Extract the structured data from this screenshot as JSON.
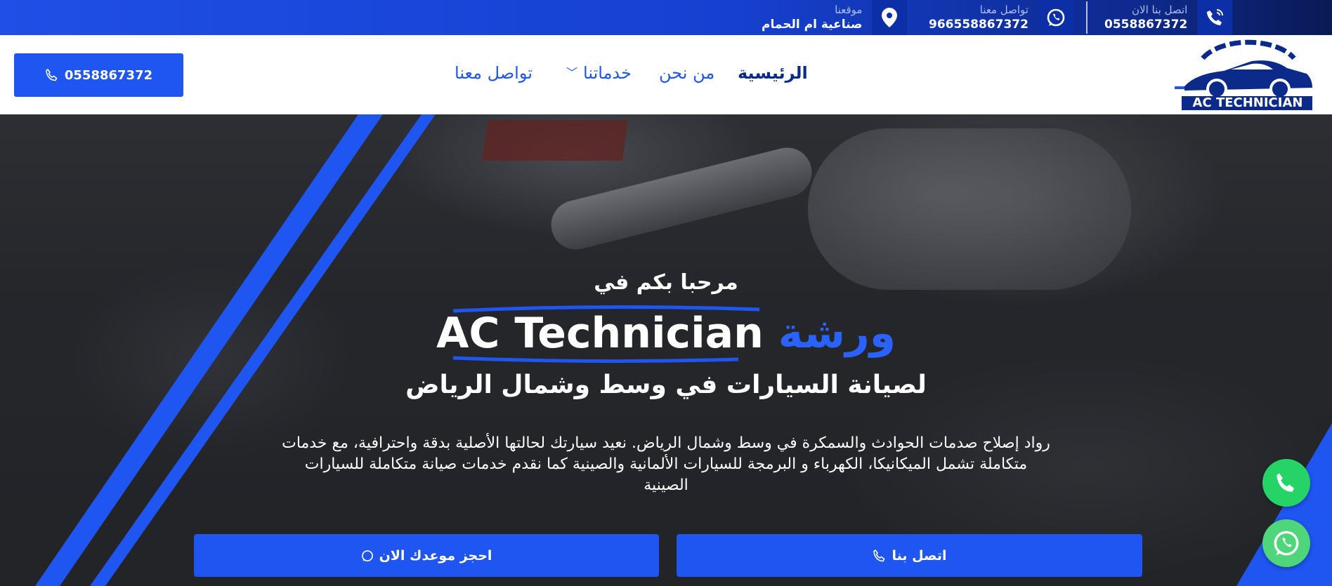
{
  "topbar": {
    "call_now": {
      "label": "اتصل بنا الان",
      "value": "0558867372",
      "icon": "phone-ring-icon"
    },
    "contact": {
      "label": "تواصل معنا",
      "value": "966558867372",
      "icon": "whatsapp-icon"
    },
    "location": {
      "label": "موقعنا",
      "value": "صناعية ام الحمام",
      "icon": "map-pin-icon"
    }
  },
  "header": {
    "call_button": "0558867372",
    "nav": {
      "home": "الرئيسية",
      "about": "من نحن",
      "services": "خدماتنا",
      "contact": "تواصل معنا"
    },
    "logo_text": "AC TECHNICIAN"
  },
  "hero": {
    "welcome": "مرحبا بكم في",
    "title_word": "ورشة",
    "title_brand": "AC Technician",
    "subtitle": "لصيانة السيارات في وسط وشمال الرياض",
    "description": "رواد إصلاح صدمات الحوادث والسمكرة في وسط وشمال الرياض. نعيد سيارتك لحالتها الأصلية بدقة واحترافية، مع خدمات متكاملة تشمل الميكانيكا، الكهرباء و البرمجة للسيارات الألمانية والصينية كما نقدم خدمات صيانة متكاملة للسيارات الصينية",
    "book_button": "احجز موعدك الان",
    "call_button": "اتصل بنا"
  },
  "colors": {
    "primary": "#1f55f0",
    "dark_blue": "#0b2a8a",
    "whatsapp_green": "#25d366"
  }
}
